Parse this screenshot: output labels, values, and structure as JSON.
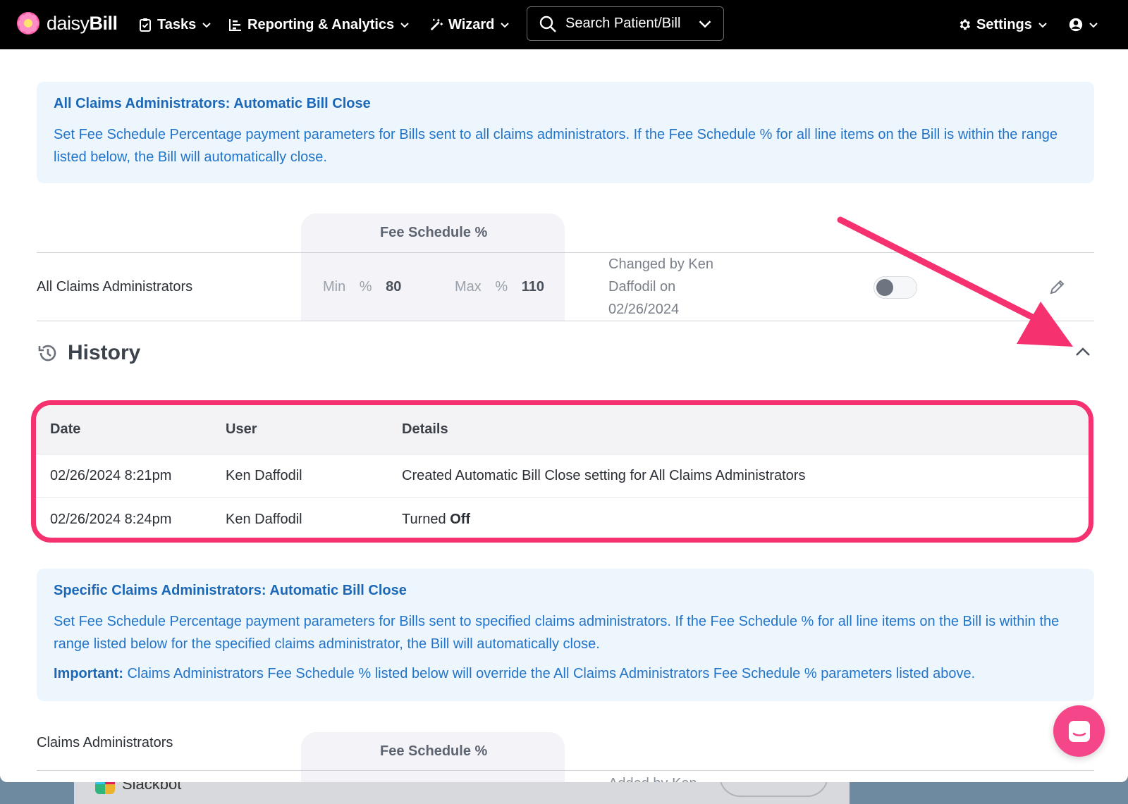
{
  "nav": {
    "brand_light": "daisy",
    "brand_bold": "Bill",
    "tasks": "Tasks",
    "reporting": "Reporting & Analytics",
    "wizard": "Wizard",
    "search_placeholder": "Search Patient/Bill",
    "settings": "Settings"
  },
  "all_admins_box": {
    "title": "All Claims Administrators: Automatic Bill Close",
    "description": "Set Fee Schedule Percentage payment parameters for Bills sent to all claims administrators. If the Fee Schedule % for all line items on the Bill is within the range listed below, the Bill will automatically close."
  },
  "all_admins_table": {
    "fee_header": "Fee Schedule %",
    "row_label": "All Claims Administrators",
    "min_label": "Min",
    "min_pct": "%",
    "min_value": "80",
    "max_label": "Max",
    "max_pct": "%",
    "max_value": "110",
    "changed_text": "Changed by Ken Daffodil on 02/26/2024",
    "toggle_on": false
  },
  "history": {
    "title": "History",
    "columns": [
      "Date",
      "User",
      "Details"
    ],
    "rows": [
      {
        "date": "02/26/2024 8:21pm",
        "user": "Ken Daffodil",
        "details": "Created Automatic Bill Close setting for All Claims Administrators",
        "details_bold": ""
      },
      {
        "date": "02/26/2024 8:24pm",
        "user": "Ken Daffodil",
        "details": "Turned ",
        "details_bold": "Off"
      }
    ]
  },
  "specific_box": {
    "title": "Specific Claims Administrators: Automatic Bill Close",
    "description": "Set Fee Schedule Percentage payment parameters for Bills sent to specified claims administrators. If the Fee Schedule % for all line items on the Bill is within the range listed below for the specified claims administrator, the Bill will automatically close.",
    "important_label": "Important:",
    "important_text": " Claims Administrators Fee Schedule % listed below will override the All Claims Administrators Fee Schedule % parameters listed above."
  },
  "specific_table": {
    "row_label": "Claims Administrators",
    "fee_header": "Fee Schedule %",
    "added_text": "Added by Ken"
  },
  "background": {
    "taskbar_app": "Slackbot"
  },
  "colors": {
    "accent_blue": "#1b67b8",
    "highlight_pink": "#f5326f",
    "chat_pink": "#f5468a"
  }
}
